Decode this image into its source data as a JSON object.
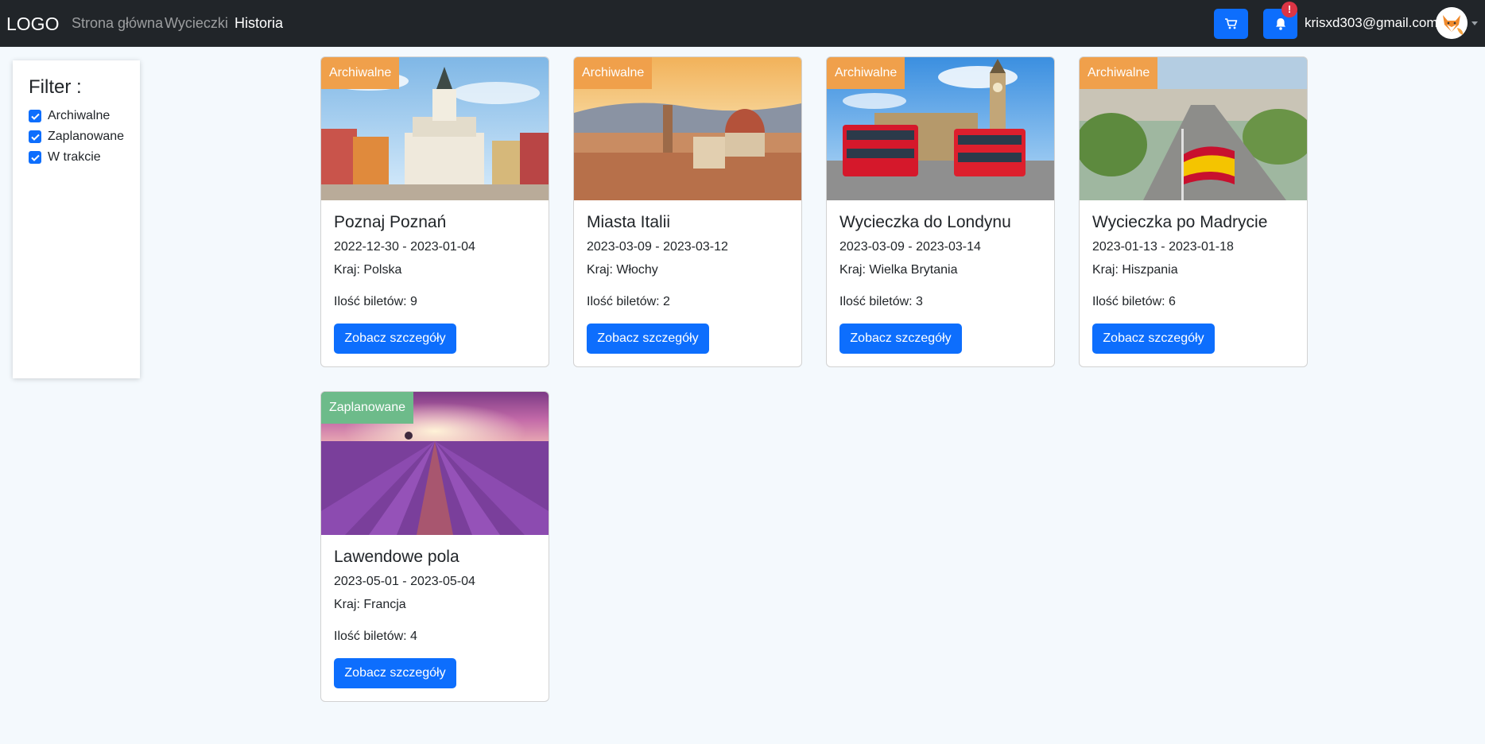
{
  "navbar": {
    "brand": "LOGO",
    "links": [
      {
        "label": "Strona główna",
        "active": false
      },
      {
        "label": "Wycieczki",
        "active": false
      },
      {
        "label": "Historia",
        "active": true
      }
    ],
    "notification_badge": "!",
    "user_email": "krisxd303@gmail.com",
    "icons": [
      "cart-icon",
      "bell-icon",
      "avatar",
      "chevron-down-icon"
    ]
  },
  "filter": {
    "title": "Filter :",
    "options": [
      {
        "label": "Archiwalne",
        "checked": true
      },
      {
        "label": "Zaplanowane",
        "checked": true
      },
      {
        "label": "W trakcie",
        "checked": true
      }
    ]
  },
  "trips": [
    {
      "status": "Archiwalne",
      "title": "Poznaj Poznań",
      "dates": "2022-12-30 - 2023-01-04",
      "country": "Kraj: Polska",
      "tickets": "Ilość biletów: 9",
      "button": "Zobacz szczegóły",
      "image": "poznan-old-town-photo"
    },
    {
      "status": "Archiwalne",
      "title": "Miasta Italii",
      "dates": "2023-03-09 - 2023-03-12",
      "country": "Kraj: Włochy",
      "tickets": "Ilość biletów: 2",
      "button": "Zobacz szczegóły",
      "image": "florence-skyline-photo"
    },
    {
      "status": "Archiwalne",
      "title": "Wycieczka do Londynu",
      "dates": "2023-03-09 - 2023-03-14",
      "country": "Kraj: Wielka Brytania",
      "tickets": "Ilość biletów: 3",
      "button": "Zobacz szczegóły",
      "image": "london-buses-big-ben-photo"
    },
    {
      "status": "Archiwalne",
      "title": "Wycieczka po Madrycie",
      "dates": "2023-01-13 - 2023-01-18",
      "country": "Kraj: Hiszpania",
      "tickets": "Ilość biletów: 6",
      "button": "Zobacz szczegóły",
      "image": "madrid-aerial-flag-photo"
    },
    {
      "status": "Zaplanowane",
      "title": "Lawendowe pola",
      "dates": "2023-05-01 - 2023-05-04",
      "country": "Kraj: Francja",
      "tickets": "Ilość biletów: 4",
      "button": "Zobacz szczegóły",
      "image": "lavender-field-sunset-photo"
    }
  ],
  "colors": {
    "navbar_bg": "#212529",
    "page_bg": "#f4f9fd",
    "primary": "#0d6efd",
    "badge": "#dc3545",
    "status_archival": "#f0a04b",
    "status_planned": "#6dbb8a"
  }
}
